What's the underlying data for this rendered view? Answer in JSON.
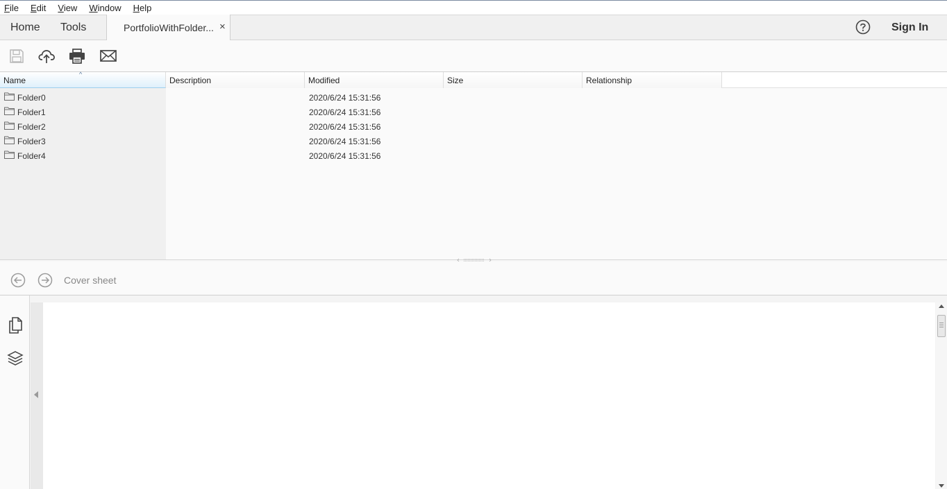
{
  "menu": {
    "items": [
      {
        "key": "F",
        "rest": "ile"
      },
      {
        "key": "E",
        "rest": "dit"
      },
      {
        "key": "V",
        "rest": "iew"
      },
      {
        "key": "W",
        "rest": "indow"
      },
      {
        "key": "H",
        "rest": "elp"
      }
    ]
  },
  "tabs": {
    "home": "Home",
    "tools": "Tools",
    "document": "PortfolioWithFolder...",
    "close_glyph": "×"
  },
  "header": {
    "help_icon": "question-circle-icon",
    "sign_in": "Sign In"
  },
  "toolbar": {
    "icons": [
      "save-icon",
      "cloud-upload-icon",
      "print-icon",
      "email-icon"
    ]
  },
  "filelist": {
    "columns": [
      "Name",
      "Description",
      "Modified",
      "Size",
      "Relationship"
    ],
    "sorted_column": "Name",
    "rows": [
      {
        "name": "Folder0",
        "description": "",
        "modified": "2020/6/24 15:31:56",
        "size": "",
        "relationship": ""
      },
      {
        "name": "Folder1",
        "description": "",
        "modified": "2020/6/24 15:31:56",
        "size": "",
        "relationship": ""
      },
      {
        "name": "Folder2",
        "description": "",
        "modified": "2020/6/24 15:31:56",
        "size": "",
        "relationship": ""
      },
      {
        "name": "Folder3",
        "description": "",
        "modified": "2020/6/24 15:31:56",
        "size": "",
        "relationship": ""
      },
      {
        "name": "Folder4",
        "description": "",
        "modified": "2020/6/24 15:31:56",
        "size": "",
        "relationship": ""
      }
    ]
  },
  "navbar": {
    "cover_sheet": "Cover sheet"
  },
  "left_rail": {
    "icons": [
      "pages-icon",
      "layers-icon"
    ]
  }
}
